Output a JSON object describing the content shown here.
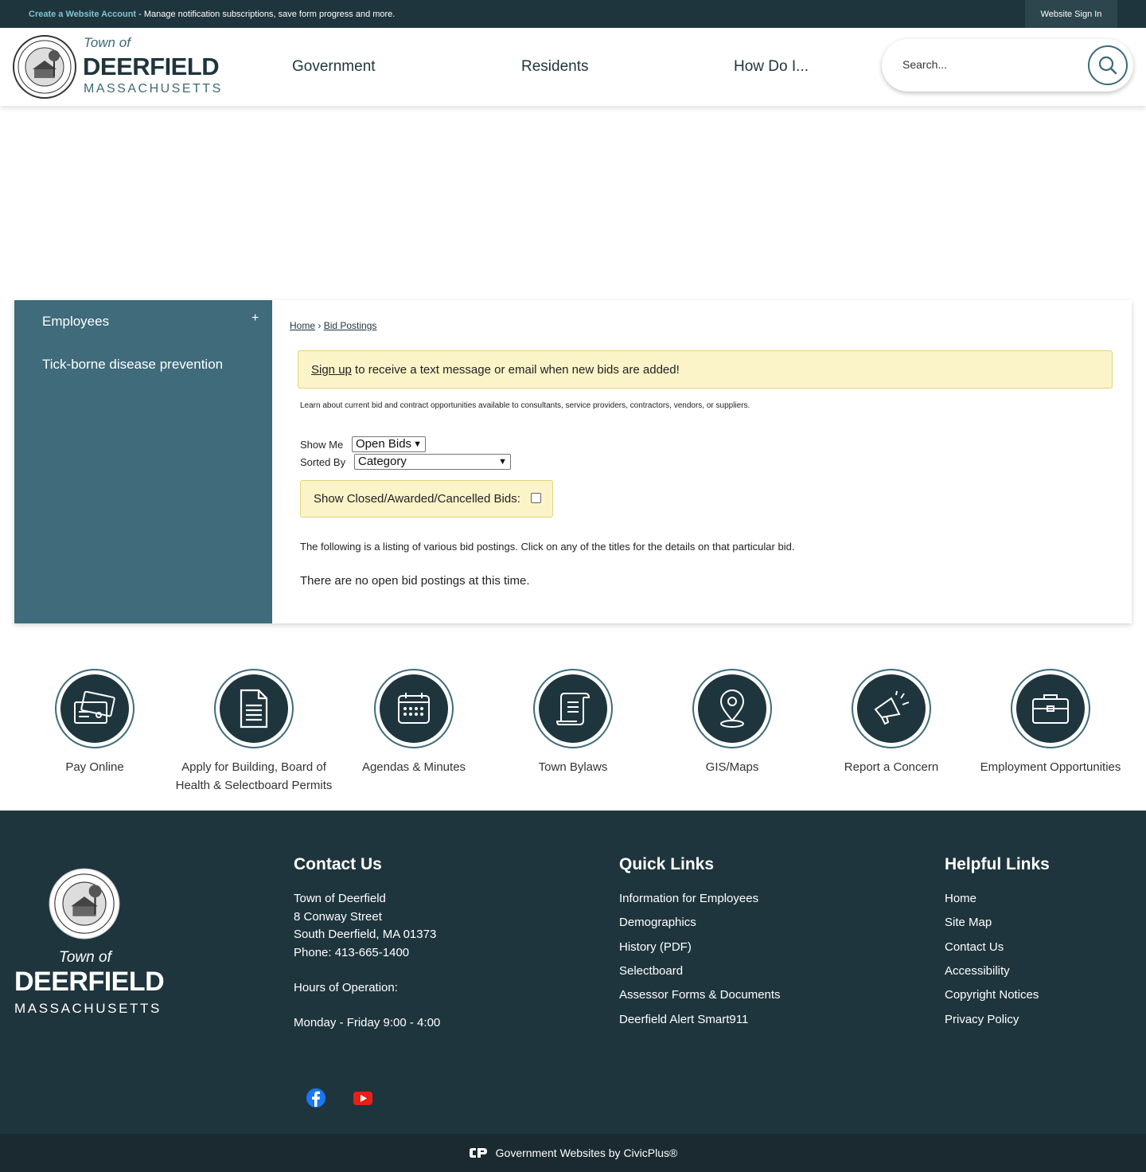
{
  "topbar": {
    "create_account": "Create a Website Account",
    "message": " - Manage notification subscriptions, save form progress and more.",
    "sign_in": "Website Sign In"
  },
  "header": {
    "town_of": "Town of",
    "name": "DEERFIELD",
    "state": "MASSACHUSETTS",
    "nav": [
      "Government",
      "Residents",
      "How Do I..."
    ],
    "search_placeholder": "Search..."
  },
  "sidebar": {
    "items": [
      {
        "label": "Employees",
        "expand": "+"
      },
      {
        "label": "Tick-borne disease prevention"
      }
    ]
  },
  "breadcrumb": {
    "home": "Home",
    "separator": "›",
    "current": "Bid Postings"
  },
  "main": {
    "alert_link": "Sign up",
    "alert_text": " to receive a text message or email when new bids are added!",
    "intro": "Learn about current bid and contract opportunities available to consultants, service providers, contractors, vendors, or suppliers.",
    "show_me_label": "Show Me",
    "show_me_value": "Open Bids",
    "sorted_by_label": "Sorted By",
    "sorted_by_value": "Category",
    "closed_label": "Show Closed/Awarded/Cancelled Bids:",
    "listing_text": "The following is a listing of various bid postings. Click on any of the titles for the details on that particular bid.",
    "no_bids": "There are no open bid postings at this time."
  },
  "quick_links": [
    {
      "label": "Pay Online",
      "icon": "credit-card-icon"
    },
    {
      "label": "Apply for Building, Board of Health & Selectboard Permits",
      "icon": "document-icon"
    },
    {
      "label": "Agendas & Minutes",
      "icon": "calendar-icon"
    },
    {
      "label": "Town Bylaws",
      "icon": "scroll-icon"
    },
    {
      "label": "GIS/Maps",
      "icon": "map-pin-icon"
    },
    {
      "label": "Report a Concern",
      "icon": "megaphone-icon"
    },
    {
      "label": "Employment Opportunities",
      "icon": "briefcase-icon"
    }
  ],
  "footer": {
    "town_of": "Town of",
    "name": "DEERFIELD",
    "state": "MASSACHUSETTS",
    "contact": {
      "heading": "Contact Us",
      "line1": "Town of Deerfield",
      "line2": "8 Conway Street",
      "line3": "South Deerfield, MA 01373",
      "phone": "Phone: 413-665-1400",
      "hours_label": "Hours of Operation:",
      "hours": "Monday - Friday 9:00 - 4:00"
    },
    "quick_links": {
      "heading": "Quick Links",
      "items": [
        "Information for Employees",
        "Demographics",
        "History (PDF)",
        "Selectboard",
        "Assessor Forms & Documents",
        "Deerfield Alert Smart911"
      ]
    },
    "helpful_links": {
      "heading": "Helpful Links",
      "items": [
        "Home",
        "Site Map",
        "Contact Us",
        "Accessibility",
        "Copyright Notices",
        "Privacy Policy"
      ]
    },
    "social": [
      "facebook-icon",
      "youtube-icon"
    ],
    "credit": "Government Websites by CivicPlus®"
  },
  "colors": {
    "dark": "#1f353d",
    "teal": "#3f6b7a",
    "alert_bg": "#fbf4c8",
    "facebook": "#1877f2",
    "youtube": "#e62117"
  }
}
